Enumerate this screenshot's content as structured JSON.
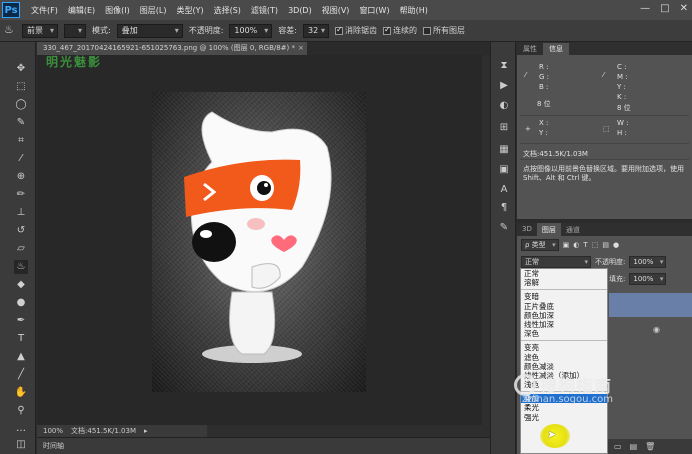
{
  "app": {
    "logo": "Ps",
    "menus": [
      "文件(F)",
      "编辑(E)",
      "图像(I)",
      "图层(L)",
      "类型(Y)",
      "选择(S)",
      "滤镜(T)",
      "3D(D)",
      "视图(V)",
      "窗口(W)",
      "帮助(H)"
    ],
    "window_controls": [
      "—",
      "□",
      "✕"
    ]
  },
  "options": {
    "fill_source": "前景",
    "mode_label": "模式:",
    "mode_value": "叠加",
    "opacity_label": "不透明度:",
    "opacity_value": "100%",
    "tolerance_label": "容差:",
    "tolerance_value": "32",
    "antialias_label": "消除锯齿",
    "contiguous_label": "连续的",
    "all_layers_label": "所有图层"
  },
  "document": {
    "tab_title": "330_467_20170424165921-651025763.png @ 100% (图层 0, RGB/8#) *",
    "tab_close": "×",
    "watermark": "明光魅影",
    "zoom": "100%",
    "doc_size": "文档:451.5K/1.03M",
    "timeline": "时间轴"
  },
  "panels": {
    "top_tabs": [
      "属性",
      "信息"
    ],
    "info": {
      "r": "R :",
      "g": "G :",
      "b": "B :",
      "c": "C :",
      "m": "M :",
      "y": "Y :",
      "k": "K :",
      "bit_left": "8 位",
      "bit_right": "8 位",
      "x": "X :",
      "yy": "Y :",
      "w": "W :",
      "h": "H :",
      "doc": "文档:451.5K/1.03M",
      "hint": "点按图像以用前景色替换区域。要用附加选项，使用 Shift、Alt 和 Ctrl 键。"
    },
    "layers_tabs": [
      "3D",
      "图层",
      "通道"
    ],
    "kind_filter": "ρ 类型",
    "blend_current": "正常",
    "opacity_label": "不透明度:",
    "opacity_value": "100%",
    "fill_label": "填充:",
    "fill_value": "100%"
  },
  "blend_modes": {
    "group1": [
      "正常",
      "溶解"
    ],
    "group2": [
      "变暗",
      "正片叠底",
      "颜色加深",
      "线性加深",
      "深色"
    ],
    "group3": [
      "变亮",
      "滤色",
      "颜色减淡",
      "线性减淡（添加）",
      "浅色"
    ],
    "group4": [
      "叠加",
      "柔光",
      "强光"
    ],
    "highlighted": "叠加"
  },
  "overlay": {
    "brand": "搜狗指南",
    "url": "zhinan.sogou.com"
  }
}
